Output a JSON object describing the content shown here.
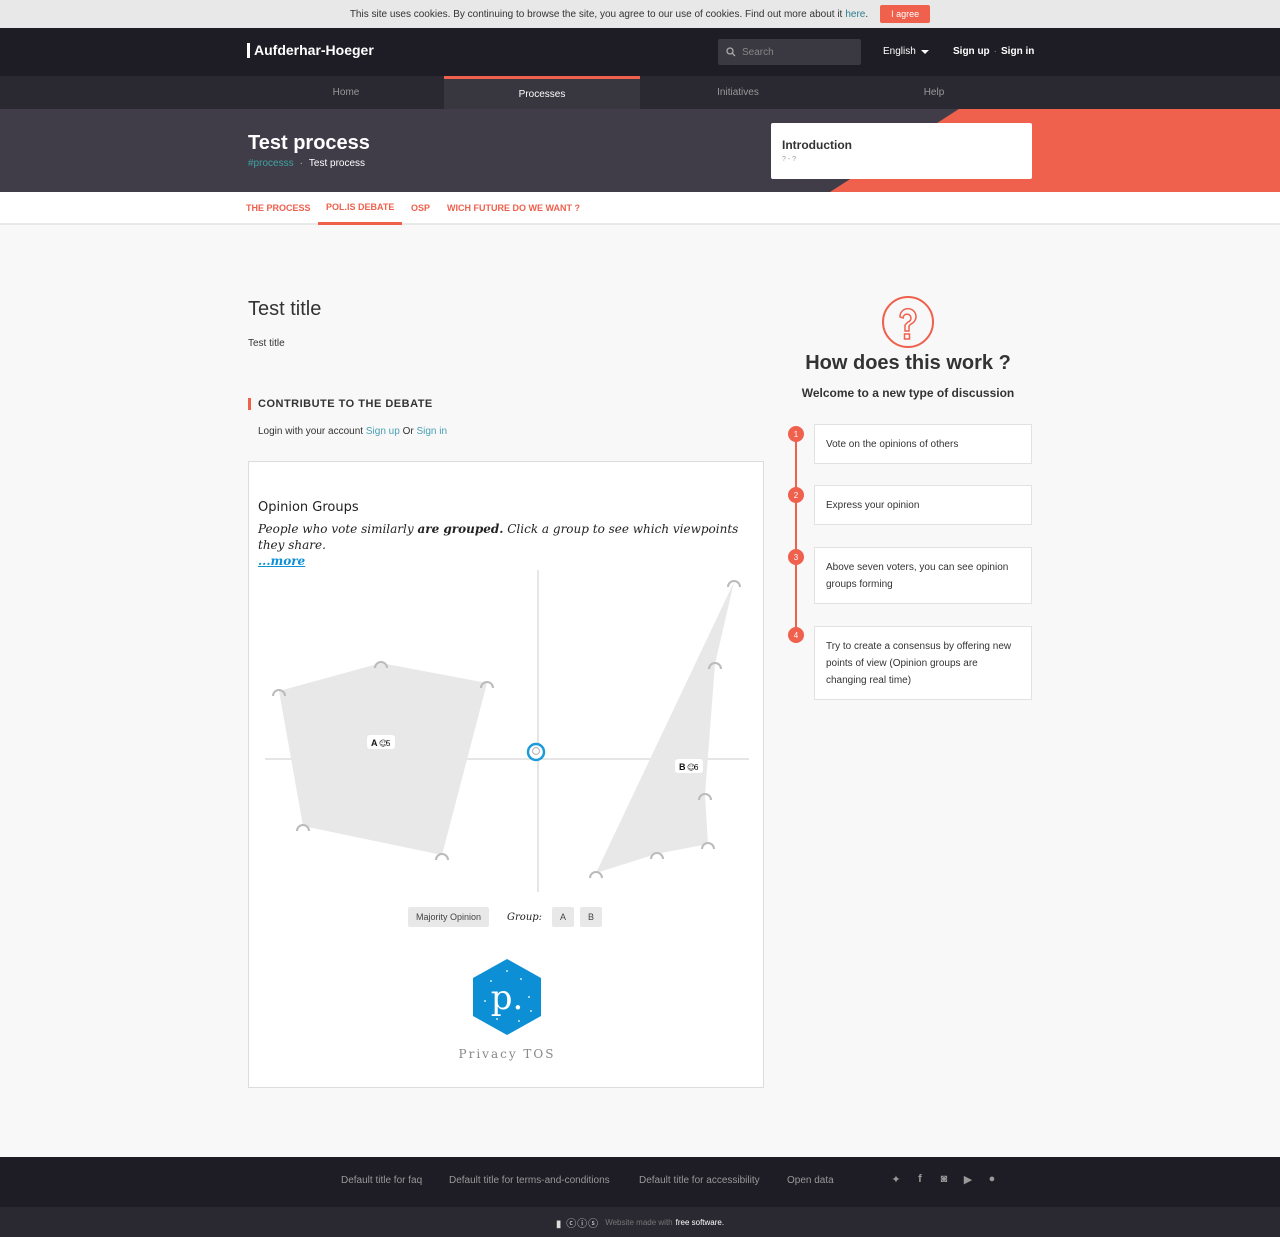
{
  "cookie": {
    "text": "This site uses cookies. By continuing to browse the site, you agree to our use of cookies. Find out more about it",
    "link": "here",
    "agree": "I agree"
  },
  "header": {
    "logo": "Aufderhar-Hoeger",
    "search_placeholder": "Search",
    "language": "English",
    "sign_up": "Sign up",
    "sign_in": "Sign in"
  },
  "nav": {
    "items": [
      "Home",
      "Processes",
      "Initiatives",
      "Help"
    ],
    "active": "Processes"
  },
  "hero": {
    "title": "Test process",
    "tag": "#processs",
    "breadcrumb": "Test process",
    "phase_title": "Introduction",
    "phase_dates": "? - ?"
  },
  "subnav": {
    "items": [
      "THE PROCESS",
      "POL.IS DEBATE",
      "OSP",
      "WICH FUTURE DO WE WANT ?"
    ],
    "active": "POL.IS DEBATE"
  },
  "content": {
    "title": "Test title",
    "subtitle": "Test title",
    "contribute": "CONTRIBUTE TO THE DEBATE",
    "login_prefix": "Login with your account",
    "login_signup": "Sign up",
    "login_or": "Or",
    "login_signin": "Sign in"
  },
  "polis": {
    "heading": "Opinion Groups",
    "desc_start": "People who vote similarly",
    "desc_bold": "are grouped.",
    "desc_end": "Click a group to see which viewpoints they share.",
    "more": "...more",
    "group_a_label": "A",
    "group_a_count": "5",
    "group_b_label": "B",
    "group_b_count": "6",
    "majority_button": "Majority Opinion",
    "group_label": "Group:",
    "group_buttons": [
      "A",
      "B"
    ],
    "footer_links": "Privacy TOS",
    "logo_letter": "p."
  },
  "help": {
    "title": "How does this work ?",
    "subtitle": "Welcome to a new type of discussion",
    "steps": [
      {
        "num": "1",
        "text": "Vote on the opinions of others"
      },
      {
        "num": "2",
        "text": "Express your opinion"
      },
      {
        "num": "3",
        "text": "Above seven voters, you can see opinion groups forming"
      },
      {
        "num": "4",
        "text": "Try to create a consensus by offering new points of view (Opinion groups are changing real time)"
      }
    ]
  },
  "footer": {
    "links": [
      "Default title for faq",
      "Default title for terms-and-conditions",
      "Default title for accessibility",
      "Open data"
    ],
    "social": [
      "twitter-icon",
      "facebook-icon",
      "instagram-icon",
      "youtube-icon",
      "github-icon"
    ],
    "made_with": "Website made with",
    "free_software": "free software."
  },
  "colors": {
    "accent": "#ef604d",
    "dark": "#1e1c24",
    "polis_blue": "#0d8fd6"
  }
}
